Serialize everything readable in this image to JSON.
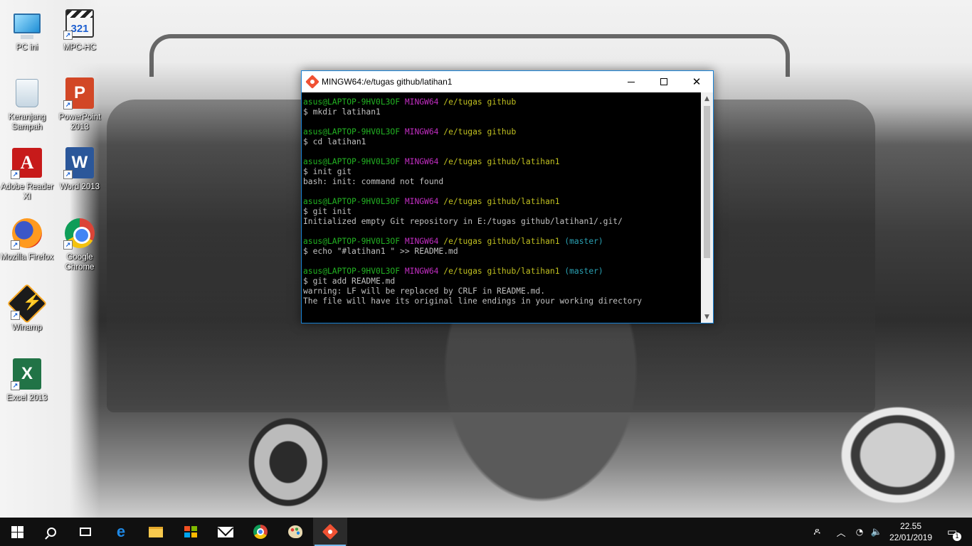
{
  "desktop": {
    "icons": [
      {
        "label": "PC ini",
        "icon": "computer-icon"
      },
      {
        "label": "MPC-HC",
        "icon": "mpc-hc-icon",
        "glyph": "321"
      },
      {
        "label": "Keranjang Sampah",
        "icon": "recycle-bin-icon"
      },
      {
        "label": "PowerPoint 2013",
        "icon": "powerpoint-icon",
        "glyph": "P"
      },
      {
        "label": "Adobe Reader XI",
        "icon": "adobe-reader-icon",
        "glyph": "A"
      },
      {
        "label": "Word 2013",
        "icon": "word-icon",
        "glyph": "W"
      },
      {
        "label": "Mozilla Firefox",
        "icon": "firefox-icon"
      },
      {
        "label": "Google Chrome",
        "icon": "chrome-icon"
      },
      {
        "label": "Winamp",
        "icon": "winamp-icon"
      },
      {
        "label": "Excel 2013",
        "icon": "excel-icon",
        "glyph": "X"
      }
    ]
  },
  "terminal": {
    "title": "MINGW64:/e/tugas github/latihan1",
    "lines": [
      {
        "user": "asus@LAPTOP-9HV0L3OF",
        "host": "MINGW64",
        "path": "/e/tugas github",
        "branch": ""
      },
      {
        "text": "$ mkdir latihan1"
      },
      {
        "text": ""
      },
      {
        "user": "asus@LAPTOP-9HV0L3OF",
        "host": "MINGW64",
        "path": "/e/tugas github",
        "branch": ""
      },
      {
        "text": "$ cd latihan1"
      },
      {
        "text": ""
      },
      {
        "user": "asus@LAPTOP-9HV0L3OF",
        "host": "MINGW64",
        "path": "/e/tugas github/latihan1",
        "branch": ""
      },
      {
        "text": "$ init git"
      },
      {
        "text": "bash: init: command not found"
      },
      {
        "text": ""
      },
      {
        "user": "asus@LAPTOP-9HV0L3OF",
        "host": "MINGW64",
        "path": "/e/tugas github/latihan1",
        "branch": ""
      },
      {
        "text": "$ git init"
      },
      {
        "text": "Initialized empty Git repository in E:/tugas github/latihan1/.git/"
      },
      {
        "text": ""
      },
      {
        "user": "asus@LAPTOP-9HV0L3OF",
        "host": "MINGW64",
        "path": "/e/tugas github/latihan1",
        "branch": "(master)"
      },
      {
        "text": "$ echo \"#latihan1 \" >> README.md"
      },
      {
        "text": ""
      },
      {
        "user": "asus@LAPTOP-9HV0L3OF",
        "host": "MINGW64",
        "path": "/e/tugas github/latihan1",
        "branch": "(master)"
      },
      {
        "text": "$ git add README.md"
      },
      {
        "text": "warning: LF will be replaced by CRLF in README.md."
      },
      {
        "text": "The file will have its original line endings in your working directory"
      }
    ],
    "colors": {
      "user": "#22b322",
      "host": "#c22dc2",
      "path": "#c0c020",
      "branch": "#2aa1b3",
      "text": "#c0c0c0",
      "background": "#000000"
    },
    "controls": {
      "minimize": "minimize-icon",
      "maximize": "maximize-icon",
      "close": "close-icon"
    }
  },
  "taskbar": {
    "apps": [
      {
        "name": "start",
        "icon": "windows-logo-icon"
      },
      {
        "name": "search",
        "icon": "search-icon"
      },
      {
        "name": "task-view",
        "icon": "task-view-icon"
      },
      {
        "name": "edge",
        "icon": "edge-icon",
        "glyph": "e"
      },
      {
        "name": "file-explorer",
        "icon": "folder-icon"
      },
      {
        "name": "store",
        "icon": "store-icon"
      },
      {
        "name": "mail",
        "icon": "mail-icon"
      },
      {
        "name": "chrome",
        "icon": "chrome-icon"
      },
      {
        "name": "paint",
        "icon": "paint-icon"
      },
      {
        "name": "git-bash",
        "icon": "git-bash-icon",
        "active": true
      }
    ],
    "tray": {
      "people_icon": "people-icon",
      "chevron_icon": "chevron-up-icon",
      "wifi_icon": "wifi-icon",
      "volume_icon": "volume-icon",
      "time": "22.55",
      "date": "22/01/2019",
      "notifications_icon": "notifications-icon",
      "notifications_count": "1"
    }
  }
}
